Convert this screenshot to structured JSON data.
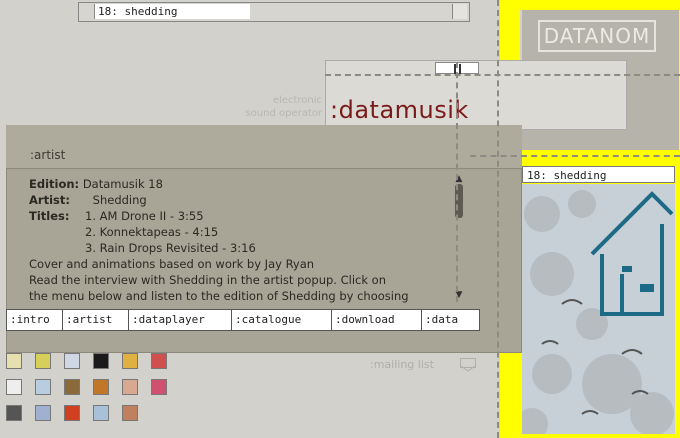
{
  "top_bar": {
    "label": "18: shedding"
  },
  "brand": {
    "logo": "DATANOM",
    "title": ":datamusik",
    "subtitle_line1": "electronic",
    "subtitle_line2": "sound operator"
  },
  "artist_panel": {
    "heading": ":artist",
    "edition_label": "Edition:",
    "edition_value": "Datamusik 18",
    "artist_label": "Artist:",
    "artist_value": "Shedding",
    "titles_label": "Titles:",
    "tracks": [
      "1.   AM Drone II  -  3:55",
      "2.   Konnektapeas  -  4:15",
      "3.   Rain Drops Revisited  -  3:16"
    ],
    "line1": "Cover and animations based on work by Jay Ryan",
    "line2": "Read the interview with Shedding in the artist popup. Click on",
    "line3": "the menu below and listen to the edition of Shedding by choosing"
  },
  "menu": [
    ":intro",
    ":artist",
    ":dataplayer",
    ":catalogue",
    ":download",
    ":data"
  ],
  "mailing_list": ":mailing list",
  "artwork": {
    "title": "18: shedding"
  },
  "thumb_colors": [
    "#e6e0b0",
    "#d6d05a",
    "#cfd7e4",
    "#1a1a1a",
    "#e0b040",
    "#d05050",
    "#eeeeee",
    "#b8cde0",
    "#8a6a3a",
    "#c07828",
    "#d8a890",
    "#d05070",
    "#555555",
    "#a0b0d0",
    "#d04020",
    "#a8c0d8",
    "#c08060"
  ],
  "colors": {
    "accent_title": "#7a1a1a",
    "yellow": "#ffff00",
    "panel": "#a8a496"
  }
}
